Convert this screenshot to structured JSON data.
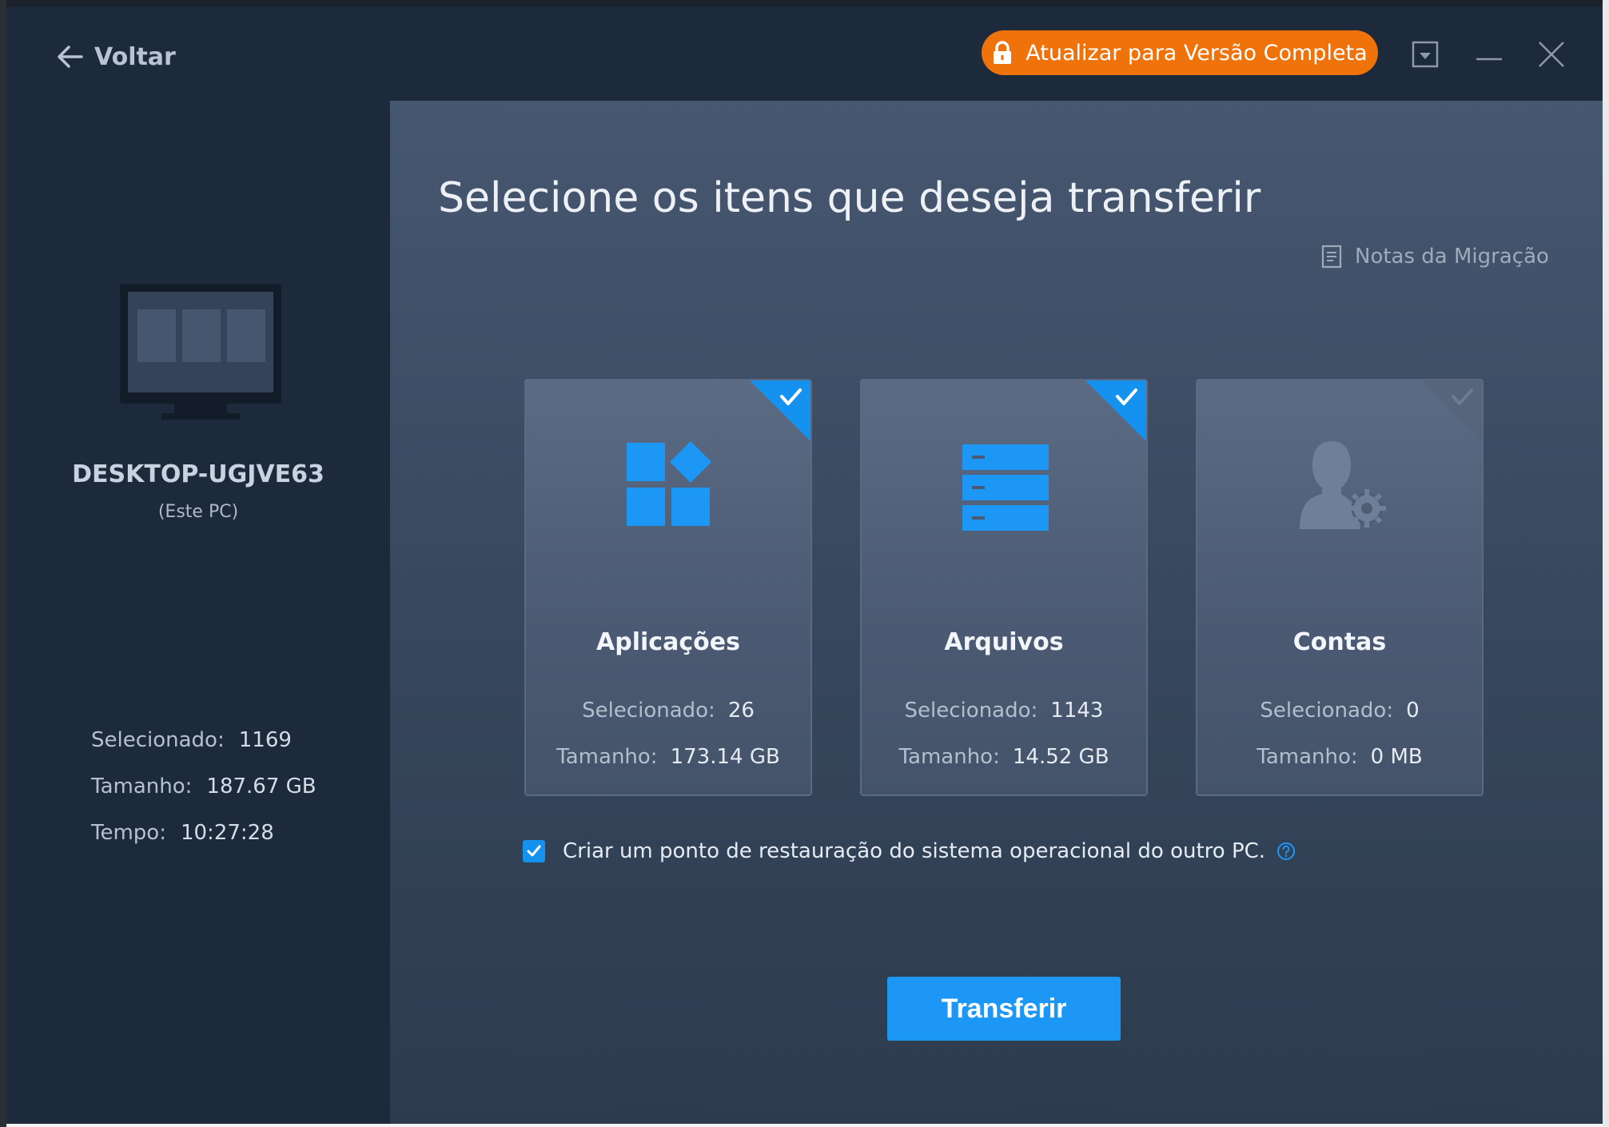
{
  "titlebar": {
    "back_label": "Voltar",
    "upgrade_label": "Atualizar para Versão Completa"
  },
  "sidebar": {
    "pc_name": "DESKTOP-UGJVE63",
    "pc_subtitle": "(Este PC)",
    "stats": [
      {
        "label": "Selecionado:",
        "value": "1169"
      },
      {
        "label": "Tamanho:",
        "value": "187.67 GB"
      },
      {
        "label": "Tempo:",
        "value": "10:27:28"
      }
    ]
  },
  "main": {
    "heading": "Selecione os itens que deseja transferir",
    "notes_label": "Notas da Migração",
    "cards": [
      {
        "title": "Aplicações",
        "selected_label": "Selecionado:",
        "selected": "26",
        "size_label": "Tamanho:",
        "size": "173.14 GB",
        "checked": true,
        "icon": "apps-icon"
      },
      {
        "title": "Arquivos",
        "selected_label": "Selecionado:",
        "selected": "1143",
        "size_label": "Tamanho:",
        "size": "14.52 GB",
        "checked": true,
        "icon": "files-icon"
      },
      {
        "title": "Contas",
        "selected_label": "Selecionado:",
        "selected": "0",
        "size_label": "Tamanho:",
        "size": "0 MB",
        "checked": false,
        "icon": "account-settings-icon"
      }
    ],
    "restore_point_label": "Criar um ponto de restauração do sistema operacional do outro PC.",
    "restore_point_checked": true,
    "transfer_label": "Transferir"
  },
  "colors": {
    "accent": "#1c97f5",
    "upgrade": "#f0720a",
    "sidebar_bg": "#1d2a3b",
    "panel_bg": "#3d4d64"
  }
}
